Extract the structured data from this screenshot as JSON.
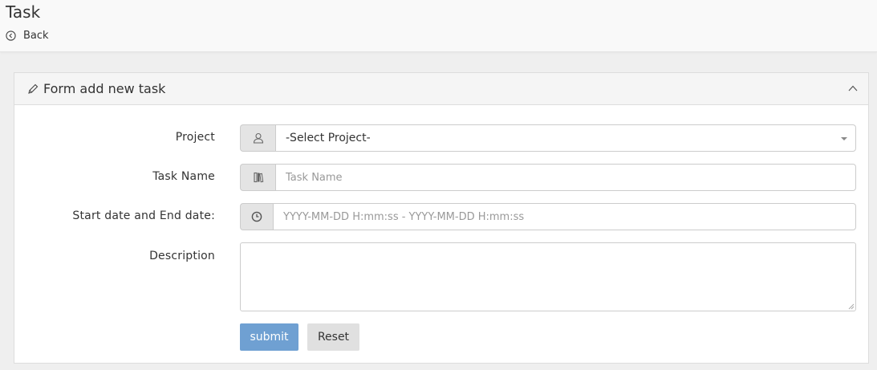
{
  "header": {
    "title": "Task",
    "back_label": "Back"
  },
  "panel": {
    "title": "Form add new task"
  },
  "form": {
    "project": {
      "label": "Project",
      "selected": "-Select Project-"
    },
    "task_name": {
      "label": "Task Name",
      "placeholder": "Task Name",
      "value": ""
    },
    "dates": {
      "label": "Start date and End date:",
      "placeholder": "YYYY-MM-DD H:mm:ss - YYYY-MM-DD H:mm:ss",
      "value": ""
    },
    "description": {
      "label": "Description",
      "value": ""
    }
  },
  "buttons": {
    "submit": "submit",
    "reset": "Reset"
  },
  "colors": {
    "submit_bg": "#6fa0d2",
    "addon_bg": "#e4e4e4"
  },
  "icons": {
    "back": "circle-chevron-left-icon",
    "panel": "pencil-icon",
    "collapse": "chevron-up-icon",
    "project": "user-icon",
    "task_name": "book-icon",
    "dates": "clock-icon"
  }
}
